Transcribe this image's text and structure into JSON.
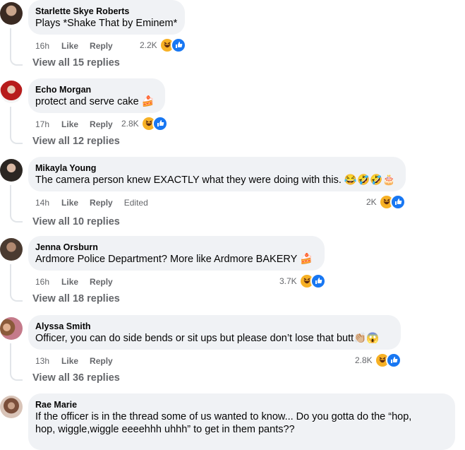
{
  "comments": [
    {
      "author": "Starlette Skye Roberts",
      "text": "Plays *Shake That by Eminem*",
      "time": "16h",
      "like": "Like",
      "reply": "Reply",
      "edited": "",
      "reactions": "2.2K",
      "view_replies": "View all 15 replies"
    },
    {
      "author": "Echo Morgan",
      "text": "protect and serve cake 🍰",
      "time": "17h",
      "like": "Like",
      "reply": "Reply",
      "edited": "",
      "reactions": "2.8K",
      "view_replies": "View all 12 replies"
    },
    {
      "author": "Mikayla Young",
      "text": "The camera person knew EXACTLY what they were doing with this. 😂🤣🤣🎂",
      "time": "14h",
      "like": "Like",
      "reply": "Reply",
      "edited": "Edited",
      "reactions": "2K",
      "view_replies": "View all 10 replies"
    },
    {
      "author": "Jenna Orsburn",
      "text": "Ardmore Police Department? More like Ardmore BAKERY 🍰",
      "time": "16h",
      "like": "Like",
      "reply": "Reply",
      "edited": "",
      "reactions": "3.7K",
      "view_replies": "View all 18 replies"
    },
    {
      "author": "Alyssa Smith",
      "text": "Officer, you can do side bends or sit ups but please don’t lose that butt👏🏼😱",
      "time": "13h",
      "like": "Like",
      "reply": "Reply",
      "edited": "",
      "reactions": "2.8K",
      "view_replies": "View all 36 replies"
    },
    {
      "author": "Rae Marie",
      "text_line1": "If the officer is in the thread some of us wanted to know... Do you gotta do the “hop,",
      "text_line2": "hop, wiggle,wiggle eeeehhh uhhh” to get in them pants??"
    }
  ],
  "colors": {
    "like_blue": "#1877f2",
    "haha_yellow": "#f7b125",
    "bubble": "#f0f2f5",
    "meta": "#65676b"
  },
  "icons": [
    "haha-reaction-icon",
    "like-reaction-icon"
  ]
}
